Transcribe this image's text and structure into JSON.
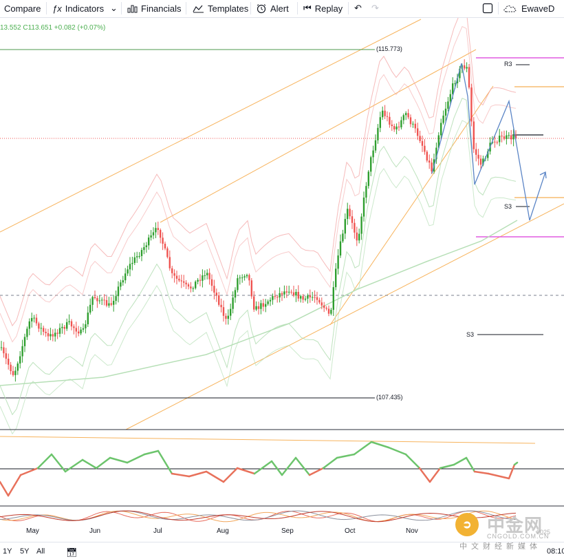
{
  "toolbar": {
    "compare_label": "Compare",
    "indicators_label": "Indicators",
    "financials_label": "Financials",
    "templates_label": "Templates",
    "alert_label": "Alert",
    "replay_label": "Replay",
    "layout_label": "EwaveD"
  },
  "legend": {
    "low": "13.552",
    "close_prefix": "C",
    "close": "113.651",
    "change": "+0.082",
    "change_pct": "(+0.07%)"
  },
  "levels": {
    "upper_price": "(115.773)",
    "lower_price": "(107.435)",
    "pivot_r3": "R3",
    "pivot_s3_a": "S3",
    "pivot_s3_b": "S3"
  },
  "time_axis": [
    "May",
    "Jun",
    "Jul",
    "Aug",
    "Sep",
    "Oct",
    "Nov"
  ],
  "bottom": {
    "range_1y": "1Y",
    "range_5y": "5Y",
    "range_all": "All",
    "clock": "08:10"
  },
  "watermark": {
    "brand_cn": "中金网",
    "brand_en": "CNGOLD.COM.CN",
    "year": "2025",
    "tagline": "中文财经新媒体"
  },
  "colors": {
    "up": "#26a69a",
    "up_green": "#2e9e2e",
    "down": "#ef5350",
    "channel": "#f7b35c",
    "bollinger": "#f4a9a9",
    "ma_light": "#b6dfb6",
    "pivot_pink": "#e05ae0",
    "pivot_orange": "#f39b2a",
    "projection": "#5b85c6",
    "rsi_up": "#6cc46c",
    "rsi_down": "#e8715b"
  }
}
